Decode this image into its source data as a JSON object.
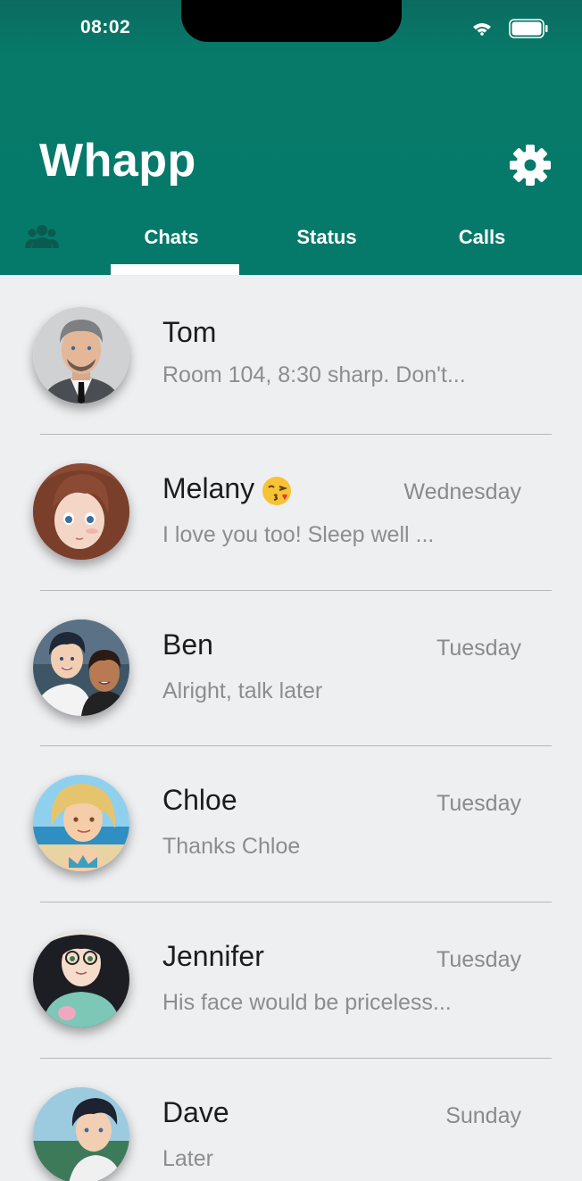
{
  "status_bar": {
    "time": "08:02"
  },
  "header": {
    "title": "Whapp"
  },
  "tabs": [
    {
      "label": "Chats",
      "active": true
    },
    {
      "label": "Status",
      "active": false
    },
    {
      "label": "Calls",
      "active": false
    }
  ],
  "chats": [
    {
      "name": "Tom",
      "day": "",
      "preview": "Room 104, 8:30 sharp. Don't..."
    },
    {
      "name": "Melany",
      "emoji": "kissing-face-icon",
      "day": "Wednesday",
      "preview": "I love you too! Sleep well ..."
    },
    {
      "name": "Ben",
      "day": "Tuesday",
      "preview": "Alright, talk later"
    },
    {
      "name": "Chloe",
      "day": "Tuesday",
      "preview": "Thanks Chloe"
    },
    {
      "name": "Jennifer",
      "day": "Tuesday",
      "preview": "His face would be priceless..."
    },
    {
      "name": "Dave",
      "day": "Sunday",
      "preview": "Later"
    }
  ]
}
